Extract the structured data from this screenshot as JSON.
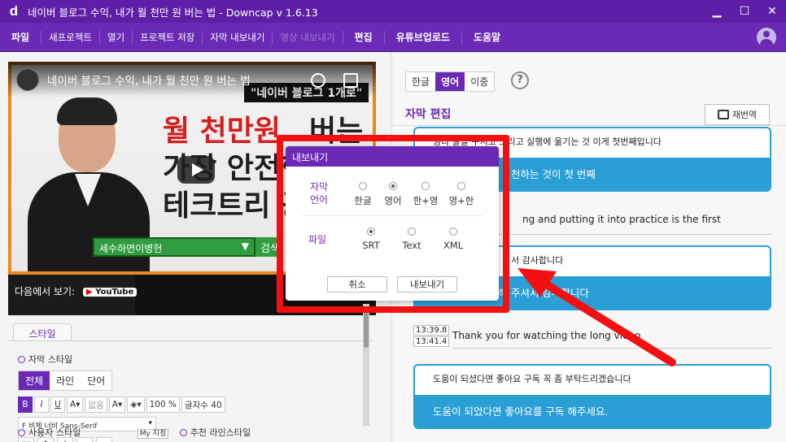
{
  "window": {
    "logo": "d",
    "title": "네이버 블로그 수익, 내가 월 천만 원 버는 법 - Downcap v 1.6.13",
    "minimize": "▁",
    "maximize": "☐",
    "close": "✕"
  },
  "menu": {
    "items": [
      {
        "label": "파일",
        "style": "bold"
      },
      {
        "label": "새프로젝트",
        "style": "normal"
      },
      {
        "label": "열기",
        "style": "normal"
      },
      {
        "label": "프로젝트 저장",
        "style": "normal"
      },
      {
        "label": "자막 내보내기",
        "style": "normal"
      },
      {
        "label": "영상 내보내기",
        "style": "dim"
      },
      {
        "label": "편집",
        "style": "bold"
      },
      {
        "label": "유튜브업로드",
        "style": "bold"
      },
      {
        "label": "도움말",
        "style": "bold"
      }
    ]
  },
  "video": {
    "title": "네이버 블로그 수익, 내가 월 천만 원 버는 법",
    "label_top": "\"네이버 블로그 1개로\"",
    "line1_red": "월 천만원",
    "line1_black": "버는",
    "line2": "가장 안전한",
    "line3": "테크트리 공개",
    "channel_bar": "세수하면이병헌",
    "channel_arrow": "▼",
    "side_btn": "검색",
    "watch_on": "다음에서 보기:",
    "youtube": "YouTube"
  },
  "style_panel": {
    "tab": "스타일",
    "subtitle_style": "자막 스타일",
    "segments": [
      "전체",
      "라인",
      "단어"
    ],
    "tools": {
      "bold": "B",
      "italic": "I",
      "underline": "U",
      "font_color": "A▾",
      "bg_none": "없음",
      "outline": "A▾",
      "fill": "◈▾",
      "size": "100 %",
      "chars": "글자수 40"
    },
    "font": "F 비체 너비 Sans-Serif",
    "font_arrow": "▾",
    "arrows": [
      "▣",
      "↑",
      "↓",
      "←",
      "→"
    ],
    "bottom": {
      "user_style": "사용자 스타일",
      "preset": "My 지정",
      "recommended": "추천 라인스타일"
    }
  },
  "right": {
    "langs": [
      "한글",
      "영어",
      "이중"
    ],
    "help": "?",
    "edit_title": "자막 편집",
    "retranslate": "재번역",
    "cards": [
      {
        "ko": "빙다 꿀을 꾸시고 그리고 실행에 옮기는 것 이게 첫번째입니다",
        "tr": "천하는 것이 첫 번째"
      },
      {
        "ko": "서 감사합니다",
        "tr": "서 시청해 주셔서 감사합니다"
      },
      {
        "ko": "도움이 되셨다면 좋아요 구독 꼭 좀 부탁드리겠습니다",
        "tr": "도움이 되었다면 좋아요를 구독 해주세요."
      }
    ],
    "plain_rows": [
      {
        "text": "ng and putting it into practice is the first",
        "t1": "",
        "t2": ""
      },
      {
        "text": "Thank you for watching the long video",
        "t1": "13:39.8",
        "t2": "13:41.4"
      }
    ]
  },
  "dialog": {
    "title": "내보내기",
    "lang_label": "자막 언어",
    "lang_options": [
      {
        "label": "한글",
        "selected": false
      },
      {
        "label": "영어",
        "selected": true
      },
      {
        "label": "한+영",
        "selected": false
      },
      {
        "label": "영+한",
        "selected": false
      }
    ],
    "file_label": "파일",
    "file_options": [
      {
        "label": "SRT",
        "selected": true
      },
      {
        "label": "Text",
        "selected": false
      },
      {
        "label": "XML",
        "selected": false
      }
    ],
    "cancel": "취소",
    "export": "내보내기"
  },
  "colors": {
    "brand": "#6a2ab5",
    "accent": "#2a9fd6",
    "highlight": "#f41010"
  }
}
